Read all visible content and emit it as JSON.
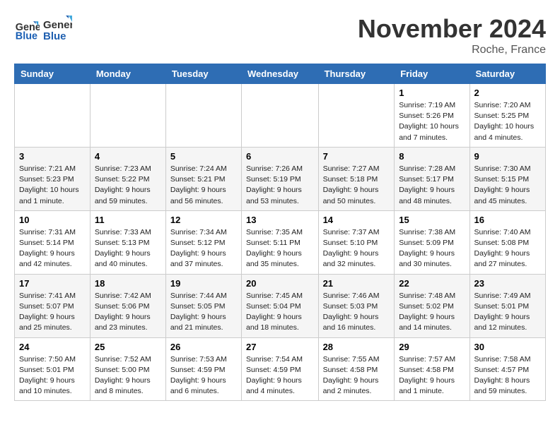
{
  "logo": {
    "line1": "General",
    "line2": "Blue"
  },
  "header": {
    "month": "November 2024",
    "location": "Roche, France"
  },
  "weekdays": [
    "Sunday",
    "Monday",
    "Tuesday",
    "Wednesday",
    "Thursday",
    "Friday",
    "Saturday"
  ],
  "weeks": [
    [
      {
        "day": "",
        "info": ""
      },
      {
        "day": "",
        "info": ""
      },
      {
        "day": "",
        "info": ""
      },
      {
        "day": "",
        "info": ""
      },
      {
        "day": "",
        "info": ""
      },
      {
        "day": "1",
        "info": "Sunrise: 7:19 AM\nSunset: 5:26 PM\nDaylight: 10 hours and 7 minutes."
      },
      {
        "day": "2",
        "info": "Sunrise: 7:20 AM\nSunset: 5:25 PM\nDaylight: 10 hours and 4 minutes."
      }
    ],
    [
      {
        "day": "3",
        "info": "Sunrise: 7:21 AM\nSunset: 5:23 PM\nDaylight: 10 hours and 1 minute."
      },
      {
        "day": "4",
        "info": "Sunrise: 7:23 AM\nSunset: 5:22 PM\nDaylight: 9 hours and 59 minutes."
      },
      {
        "day": "5",
        "info": "Sunrise: 7:24 AM\nSunset: 5:21 PM\nDaylight: 9 hours and 56 minutes."
      },
      {
        "day": "6",
        "info": "Sunrise: 7:26 AM\nSunset: 5:19 PM\nDaylight: 9 hours and 53 minutes."
      },
      {
        "day": "7",
        "info": "Sunrise: 7:27 AM\nSunset: 5:18 PM\nDaylight: 9 hours and 50 minutes."
      },
      {
        "day": "8",
        "info": "Sunrise: 7:28 AM\nSunset: 5:17 PM\nDaylight: 9 hours and 48 minutes."
      },
      {
        "day": "9",
        "info": "Sunrise: 7:30 AM\nSunset: 5:15 PM\nDaylight: 9 hours and 45 minutes."
      }
    ],
    [
      {
        "day": "10",
        "info": "Sunrise: 7:31 AM\nSunset: 5:14 PM\nDaylight: 9 hours and 42 minutes."
      },
      {
        "day": "11",
        "info": "Sunrise: 7:33 AM\nSunset: 5:13 PM\nDaylight: 9 hours and 40 minutes."
      },
      {
        "day": "12",
        "info": "Sunrise: 7:34 AM\nSunset: 5:12 PM\nDaylight: 9 hours and 37 minutes."
      },
      {
        "day": "13",
        "info": "Sunrise: 7:35 AM\nSunset: 5:11 PM\nDaylight: 9 hours and 35 minutes."
      },
      {
        "day": "14",
        "info": "Sunrise: 7:37 AM\nSunset: 5:10 PM\nDaylight: 9 hours and 32 minutes."
      },
      {
        "day": "15",
        "info": "Sunrise: 7:38 AM\nSunset: 5:09 PM\nDaylight: 9 hours and 30 minutes."
      },
      {
        "day": "16",
        "info": "Sunrise: 7:40 AM\nSunset: 5:08 PM\nDaylight: 9 hours and 27 minutes."
      }
    ],
    [
      {
        "day": "17",
        "info": "Sunrise: 7:41 AM\nSunset: 5:07 PM\nDaylight: 9 hours and 25 minutes."
      },
      {
        "day": "18",
        "info": "Sunrise: 7:42 AM\nSunset: 5:06 PM\nDaylight: 9 hours and 23 minutes."
      },
      {
        "day": "19",
        "info": "Sunrise: 7:44 AM\nSunset: 5:05 PM\nDaylight: 9 hours and 21 minutes."
      },
      {
        "day": "20",
        "info": "Sunrise: 7:45 AM\nSunset: 5:04 PM\nDaylight: 9 hours and 18 minutes."
      },
      {
        "day": "21",
        "info": "Sunrise: 7:46 AM\nSunset: 5:03 PM\nDaylight: 9 hours and 16 minutes."
      },
      {
        "day": "22",
        "info": "Sunrise: 7:48 AM\nSunset: 5:02 PM\nDaylight: 9 hours and 14 minutes."
      },
      {
        "day": "23",
        "info": "Sunrise: 7:49 AM\nSunset: 5:01 PM\nDaylight: 9 hours and 12 minutes."
      }
    ],
    [
      {
        "day": "24",
        "info": "Sunrise: 7:50 AM\nSunset: 5:01 PM\nDaylight: 9 hours and 10 minutes."
      },
      {
        "day": "25",
        "info": "Sunrise: 7:52 AM\nSunset: 5:00 PM\nDaylight: 9 hours and 8 minutes."
      },
      {
        "day": "26",
        "info": "Sunrise: 7:53 AM\nSunset: 4:59 PM\nDaylight: 9 hours and 6 minutes."
      },
      {
        "day": "27",
        "info": "Sunrise: 7:54 AM\nSunset: 4:59 PM\nDaylight: 9 hours and 4 minutes."
      },
      {
        "day": "28",
        "info": "Sunrise: 7:55 AM\nSunset: 4:58 PM\nDaylight: 9 hours and 2 minutes."
      },
      {
        "day": "29",
        "info": "Sunrise: 7:57 AM\nSunset: 4:58 PM\nDaylight: 9 hours and 1 minute."
      },
      {
        "day": "30",
        "info": "Sunrise: 7:58 AM\nSunset: 4:57 PM\nDaylight: 8 hours and 59 minutes."
      }
    ]
  ]
}
